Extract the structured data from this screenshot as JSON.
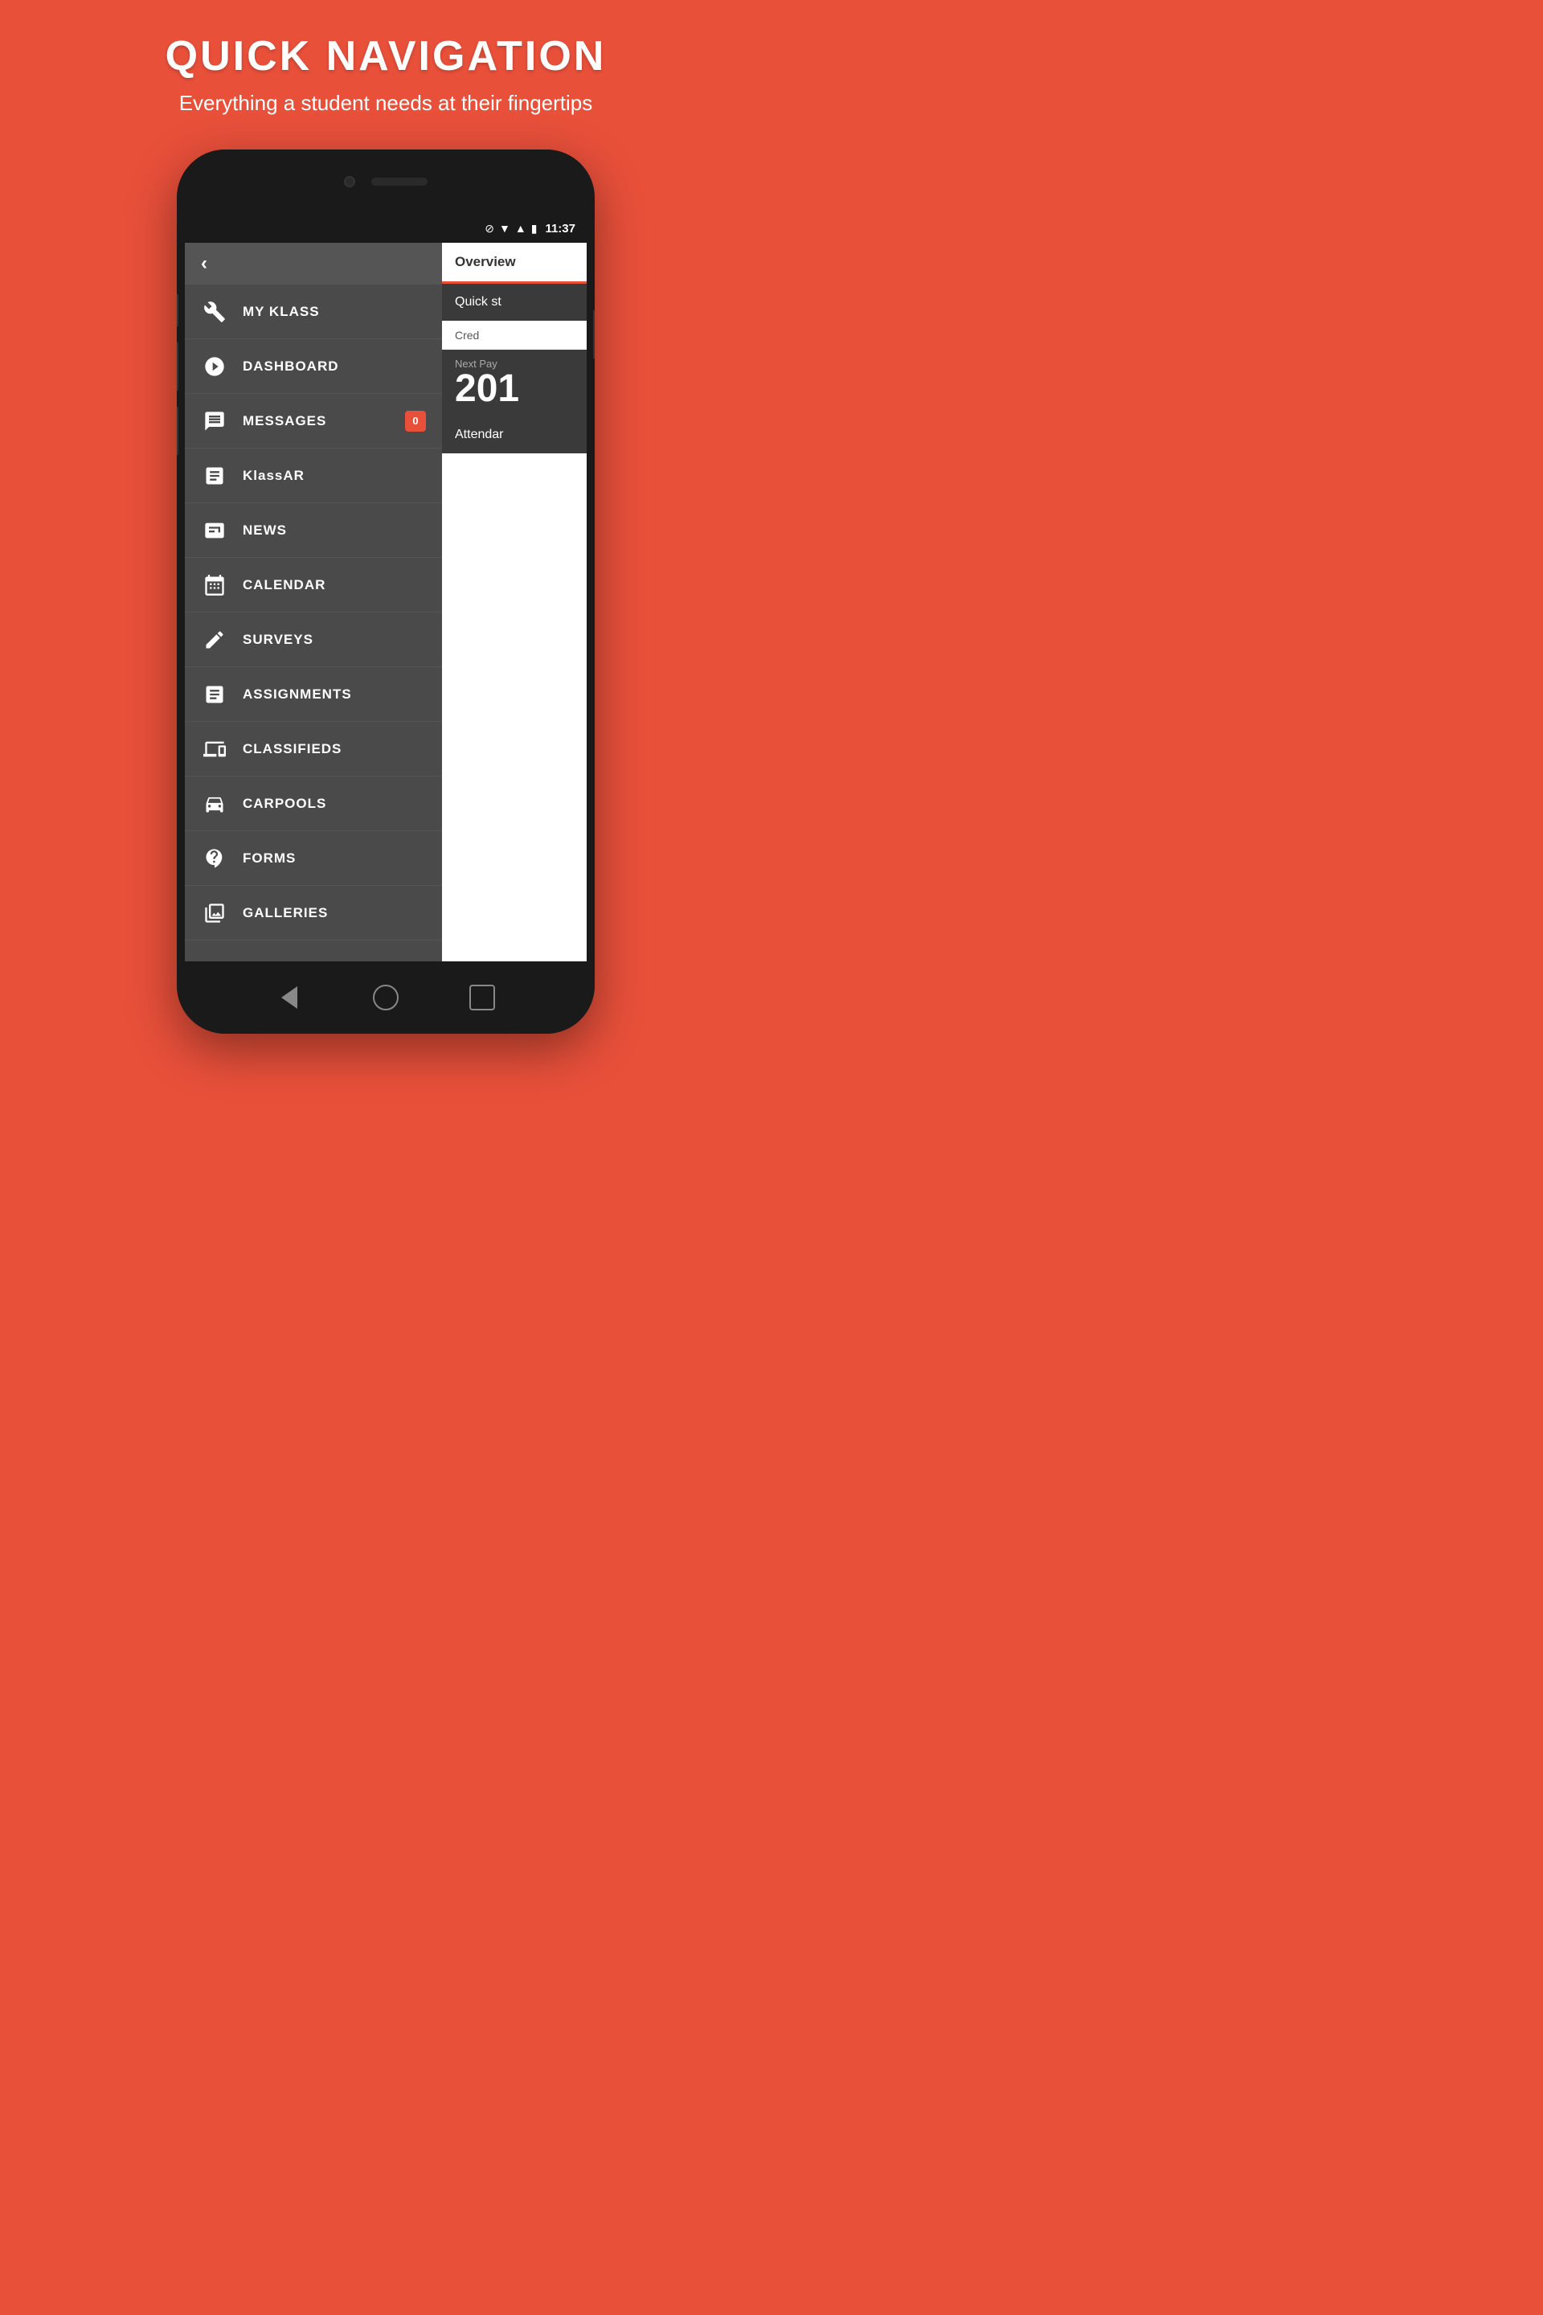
{
  "page": {
    "title": "QUICK NAVIGATION",
    "subtitle": "Everything a student needs at their fingertips"
  },
  "status_bar": {
    "time": "11:37"
  },
  "back_button": "‹",
  "menu_items": [
    {
      "id": "my-klass",
      "label": "MY KLASS",
      "badge": null
    },
    {
      "id": "dashboard",
      "label": "DASHBOARD",
      "badge": null
    },
    {
      "id": "messages",
      "label": "MESSAGES",
      "badge": "0"
    },
    {
      "id": "klassar",
      "label": "KlassAR",
      "badge": null
    },
    {
      "id": "news",
      "label": "NEWS",
      "badge": null
    },
    {
      "id": "calendar",
      "label": "CALENDAR",
      "badge": null
    },
    {
      "id": "surveys",
      "label": "SURVEYS",
      "badge": null
    },
    {
      "id": "assignments",
      "label": "ASSIGNMENTS",
      "badge": null
    },
    {
      "id": "classifieds",
      "label": "CLASSIFIEDS",
      "badge": null
    },
    {
      "id": "carpools",
      "label": "CARPOOLS",
      "badge": null
    },
    {
      "id": "forms",
      "label": "FORMS",
      "badge": null
    },
    {
      "id": "galleries",
      "label": "GALLERIES",
      "badge": null
    }
  ],
  "right_panel": {
    "tab_label": "Overview",
    "quick_start": "Quick st",
    "credit_label": "Cred",
    "next_pay_label": "Next Pay",
    "next_pay_value": "201",
    "attendance_label": "Attendar"
  }
}
